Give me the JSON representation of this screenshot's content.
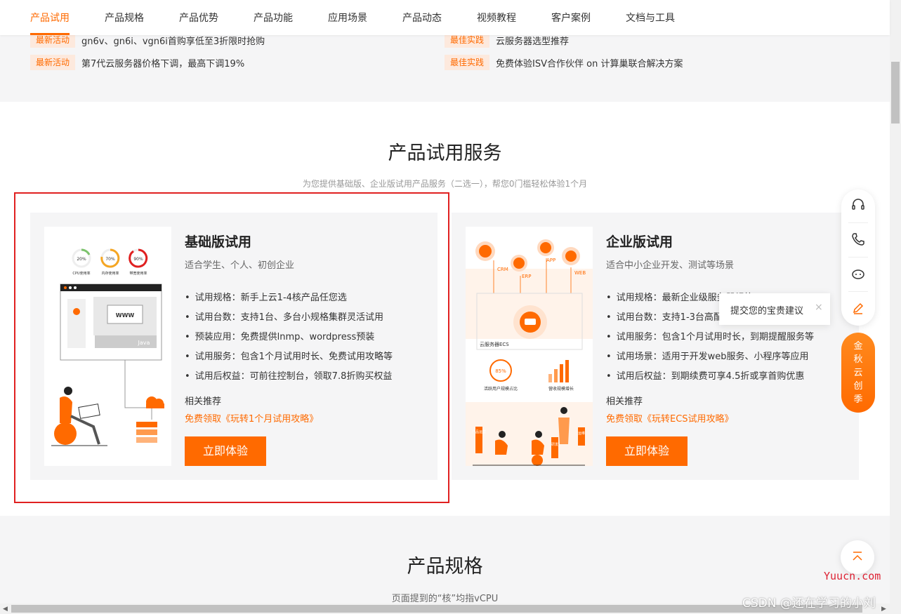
{
  "topnav": {
    "tabs": [
      {
        "label": "产品试用"
      },
      {
        "label": "产品规格"
      },
      {
        "label": "产品优势"
      },
      {
        "label": "产品功能"
      },
      {
        "label": "应用场景"
      },
      {
        "label": "产品动态"
      },
      {
        "label": "视频教程"
      },
      {
        "label": "客户案例"
      },
      {
        "label": "文档与工具"
      }
    ]
  },
  "news": {
    "left": [
      {
        "tag": "最新活动",
        "text": "gn6v、gn6i、vgn6i首购享低至3折限时抢购"
      },
      {
        "tag": "最新活动",
        "text": "第7代云服务器价格下调，最高下调19%"
      }
    ],
    "right": [
      {
        "tag": "最佳实践",
        "text": "云服务器选型推荐"
      },
      {
        "tag": "最佳实践",
        "text": "免费体验ISV合作伙伴 on 计算巢联合解决方案"
      }
    ]
  },
  "trial": {
    "title": "产品试用服务",
    "subtitle": "为您提供基础版、企业版试用产品服务（二选一），帮您0门槛轻松体验1个月",
    "basic": {
      "title": "基础版试用",
      "subtitle": "适合学生、个人、初创企业",
      "features": [
        "试用规格：新手上云1-4核产品任您选",
        "试用台数：支持1台、多台小规格集群灵活试用",
        "预装应用：免费提供lnmp、wordpress预装",
        "试用服务：包含1个月试用时长、免费试用攻略等",
        "试用后权益：可前往控制台，领取7.8折购买权益"
      ],
      "related_label": "相关推荐",
      "related_link": "免费领取《玩转1个月试用攻略》",
      "button": "立即体验",
      "illus": {
        "g1": "20%",
        "g1l": "CPU使用率",
        "g2": "70%",
        "g2l": "内存使用率",
        "g3": "90%",
        "g3l": "带宽使用率",
        "www": "WWW",
        "java": "Java"
      }
    },
    "enterprise": {
      "title": "企业版试用",
      "subtitle": "适合中小企业开发、测试等场景",
      "features": [
        "试用规格：最新企业级服务器规格",
        "试用台数：支持1-3台高配服务器试用",
        "试用服务：包含1个月试用时长，到期提醒服务等",
        "试用场景：适用于开发web服务、小程序等应用",
        "试用后权益：到期续费可享4.5折或享首购优惠"
      ],
      "related_label": "相关推荐",
      "related_link": "免费领取《玩转ECS试用攻略》",
      "button": "立即体验",
      "illus": {
        "crm": "CRM",
        "erp": "ERP",
        "app": "APP",
        "web": "WEB",
        "ecs": "云服务器ECS",
        "pct": "85%",
        "active": "活跃用户规模占比",
        "growth": "营收规模增长",
        "s1": "产品运营",
        "s2": "研发",
        "s3": "运维"
      }
    }
  },
  "spec": {
    "title": "产品规格",
    "note": "页面提到的“核”均指vCPU"
  },
  "floatbar": {
    "tooltip": "提交您的宝贵建议",
    "tooltip_close": "×",
    "promo": [
      "金",
      "秋",
      "云",
      "创",
      "季"
    ],
    "totop": "⌃"
  },
  "watermark": {
    "site": "Yuucn.com",
    "csdn": "CSDN @还在学习的小刘"
  },
  "colors": {
    "accent": "#ff6a00",
    "tag_bg": "#fde9dd",
    "highlight_border": "#e02020"
  }
}
